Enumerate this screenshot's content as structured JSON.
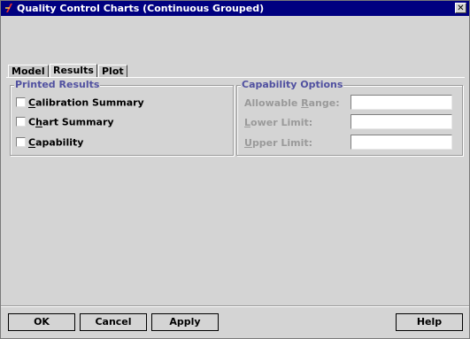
{
  "window": {
    "title": "Quality Control Charts (Continuous Grouped)",
    "close_label": "✕"
  },
  "tabs": [
    {
      "label": "Model",
      "active": false
    },
    {
      "label": "Results",
      "active": true
    },
    {
      "label": "Plot",
      "active": false
    }
  ],
  "printed_results": {
    "title": "Printed Results",
    "items": [
      {
        "mn": "C",
        "rest": "alibration Summary",
        "checked": false
      },
      {
        "pre": "C",
        "mn": "h",
        "rest": "art Summary",
        "checked": false
      },
      {
        "mn": "C",
        "rest": "apability",
        "checked": false
      }
    ]
  },
  "capability_options": {
    "title": "Capability Options",
    "allowable_range": {
      "pre": "Allowable ",
      "mn": "R",
      "rest": "ange:",
      "value": ""
    },
    "lower_limit": {
      "mn": "L",
      "rest": "ower Limit:",
      "value": ""
    },
    "upper_limit": {
      "mn": "U",
      "rest": "pper Limit:",
      "value": ""
    }
  },
  "buttons": {
    "ok": "OK",
    "cancel": "Cancel",
    "apply": "Apply",
    "help": "Help"
  }
}
